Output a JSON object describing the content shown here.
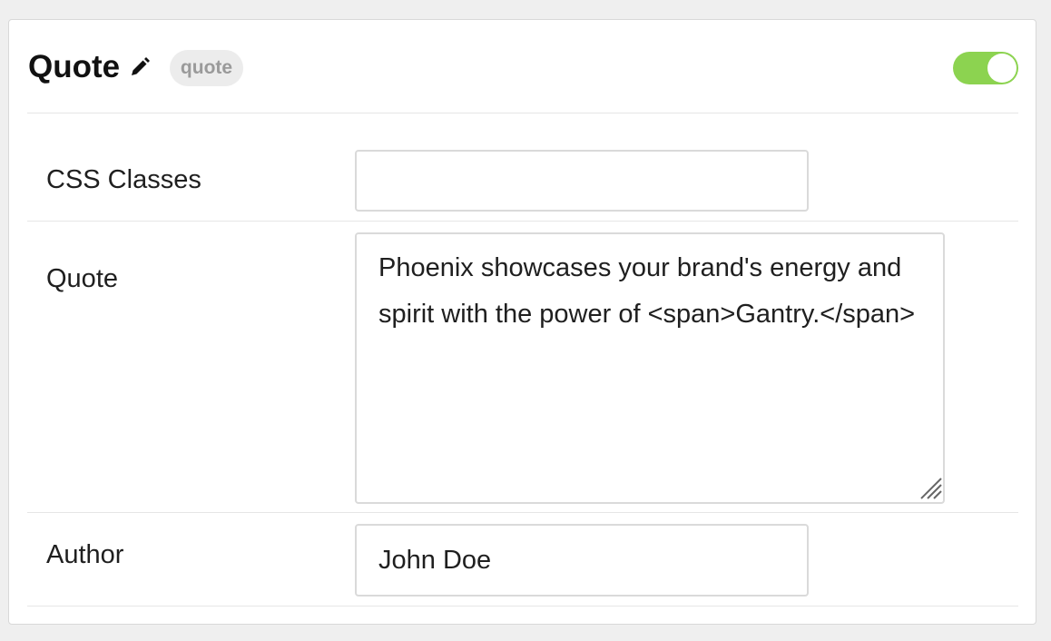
{
  "header": {
    "title": "Quote",
    "badge": "quote",
    "toggle_state": "on",
    "toggle_color": "#8cd350"
  },
  "fields": {
    "css_classes": {
      "label": "CSS Classes",
      "value": ""
    },
    "quote": {
      "label": "Quote",
      "value": "Phoenix showcases your brand's energy and spirit with the power of <span>Gantry.</span>"
    },
    "author": {
      "label": "Author",
      "value": "John Doe"
    }
  },
  "icons": {
    "edit": "pencil-icon",
    "resize": "resize-grip-icon"
  }
}
